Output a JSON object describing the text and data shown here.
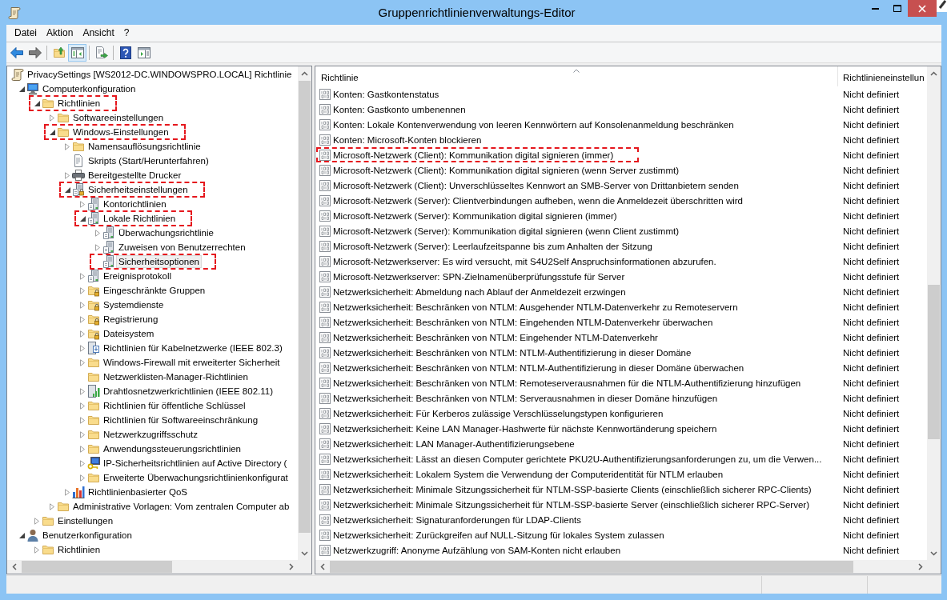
{
  "window": {
    "title": "Gruppenrichtlinienverwaltungs-Editor"
  },
  "menu": [
    {
      "label": "Datei"
    },
    {
      "label": "Aktion"
    },
    {
      "label": "Ansicht"
    },
    {
      "label": "?"
    }
  ],
  "toolbar": {
    "groups": [
      [
        {
          "kind": "back",
          "disabled": false,
          "pressed": false
        },
        {
          "kind": "forward",
          "disabled": true,
          "pressed": false
        }
      ],
      [
        {
          "kind": "up",
          "disabled": false,
          "pressed": false
        },
        {
          "kind": "tree",
          "disabled": false,
          "pressed": true
        }
      ],
      [
        {
          "kind": "export",
          "disabled": false,
          "pressed": false
        }
      ],
      [
        {
          "kind": "help",
          "disabled": false,
          "pressed": false
        },
        {
          "kind": "actions",
          "disabled": false,
          "pressed": false
        }
      ]
    ]
  },
  "console_tree": {
    "items": [
      {
        "label": "PrivacySettings [WS2012-DC.WINDOWSPRO.LOCAL] Richtlinie",
        "kind": "scroll",
        "selected": false,
        "highlighted": false,
        "children": [
          {
            "label": "Computerkonfiguration",
            "kind": "computer",
            "expanded": true,
            "selected": false,
            "highlighted": false,
            "children": [
              {
                "label": "Richtlinien",
                "kind": "folder",
                "expanded": true,
                "selected": false,
                "highlighted": true,
                "children": [
                  {
                    "label": "Softwareeinstellungen",
                    "kind": "folder",
                    "expanded": false,
                    "selected": false,
                    "highlighted": false
                  },
                  {
                    "label": "Windows-Einstellungen",
                    "kind": "folder",
                    "expanded": true,
                    "selected": false,
                    "highlighted": true,
                    "children": [
                      {
                        "label": "Namensauflösungsrichtlinie",
                        "kind": "folder",
                        "expanded": false,
                        "selected": false,
                        "highlighted": false
                      },
                      {
                        "label": "Skripts (Start/Herunterfahren)",
                        "kind": "script",
                        "selected": false,
                        "highlighted": false
                      },
                      {
                        "label": "Bereitgestellte Drucker",
                        "kind": "printer",
                        "expanded": false,
                        "selected": false,
                        "highlighted": false
                      },
                      {
                        "label": "Sicherheitseinstellungen",
                        "kind": "secured",
                        "expanded": true,
                        "selected": false,
                        "highlighted": true,
                        "children": [
                          {
                            "label": "Kontorichtlinien",
                            "kind": "policy",
                            "expanded": false,
                            "selected": false,
                            "highlighted": false
                          },
                          {
                            "label": "Lokale Richtlinien",
                            "kind": "policy",
                            "expanded": true,
                            "selected": false,
                            "highlighted": true,
                            "children": [
                              {
                                "label": "Überwachungsrichtlinie",
                                "kind": "policy",
                                "expanded": false,
                                "selected": false,
                                "highlighted": false
                              },
                              {
                                "label": "Zuweisen von Benutzerrechten",
                                "kind": "policy",
                                "expanded": false,
                                "selected": false,
                                "highlighted": false
                              },
                              {
                                "label": "Sicherheitsoptionen",
                                "kind": "policy",
                                "selected": true,
                                "highlighted": true
                              }
                            ]
                          },
                          {
                            "label": "Ereignisprotokoll",
                            "kind": "policy",
                            "expanded": false,
                            "selected": false,
                            "highlighted": false
                          },
                          {
                            "label": "Eingeschränkte Gruppen",
                            "kind": "lockfolder",
                            "expanded": false,
                            "selected": false,
                            "highlighted": false
                          },
                          {
                            "label": "Systemdienste",
                            "kind": "lockfolder",
                            "expanded": false,
                            "selected": false,
                            "highlighted": false
                          },
                          {
                            "label": "Registrierung",
                            "kind": "lockfolder",
                            "expanded": false,
                            "selected": false,
                            "highlighted": false
                          },
                          {
                            "label": "Dateisystem",
                            "kind": "lockfolder",
                            "expanded": false,
                            "selected": false,
                            "highlighted": false
                          },
                          {
                            "label": "Richtlinien für Kabelnetzwerke (IEEE 802.3)",
                            "kind": "wired",
                            "expanded": false,
                            "selected": false,
                            "highlighted": false
                          },
                          {
                            "label": "Windows-Firewall mit erweiterter Sicherheit",
                            "kind": "folder",
                            "expanded": false,
                            "selected": false,
                            "highlighted": false
                          },
                          {
                            "label": "Netzwerklisten-Manager-Richtlinien",
                            "kind": "folder",
                            "selected": false,
                            "highlighted": false
                          },
                          {
                            "label": "Drahtlosnetzwerkrichtlinien (IEEE 802.11)",
                            "kind": "wireless",
                            "expanded": false,
                            "selected": false,
                            "highlighted": false
                          },
                          {
                            "label": "Richtlinien für öffentliche Schlüssel",
                            "kind": "folder",
                            "expanded": false,
                            "selected": false,
                            "highlighted": false
                          },
                          {
                            "label": "Richtlinien für Softwareeinschränkung",
                            "kind": "folder",
                            "expanded": false,
                            "selected": false,
                            "highlighted": false
                          },
                          {
                            "label": "Netzwerkzugriffsschutz",
                            "kind": "folder",
                            "expanded": false,
                            "selected": false,
                            "highlighted": false
                          },
                          {
                            "label": "Anwendungssteuerungsrichtlinien",
                            "kind": "folder",
                            "expanded": false,
                            "selected": false,
                            "highlighted": false
                          },
                          {
                            "label": "IP-Sicherheitsrichtlinien auf Active Directory (",
                            "kind": "ipsec",
                            "expanded": false,
                            "selected": false,
                            "highlighted": false
                          },
                          {
                            "label": "Erweiterte Überwachungsrichtlinienkonfigurat",
                            "kind": "folder",
                            "expanded": false,
                            "selected": false,
                            "highlighted": false
                          }
                        ]
                      },
                      {
                        "label": "Richtlinienbasierter QoS",
                        "kind": "qos",
                        "expanded": false,
                        "selected": false,
                        "highlighted": false
                      }
                    ]
                  },
                  {
                    "label": "Administrative Vorlagen: Vom zentralen Computer ab",
                    "kind": "folder",
                    "expanded": false,
                    "selected": false,
                    "highlighted": false
                  }
                ]
              },
              {
                "label": "Einstellungen",
                "kind": "folder",
                "expanded": false,
                "selected": false,
                "highlighted": false
              }
            ]
          },
          {
            "label": "Benutzerkonfiguration",
            "kind": "user",
            "expanded": true,
            "selected": false,
            "highlighted": false,
            "children": [
              {
                "label": "Richtlinien",
                "kind": "folder",
                "expanded": false,
                "selected": false,
                "highlighted": false
              }
            ]
          }
        ]
      }
    ]
  },
  "policy_list": {
    "columns": [
      {
        "label": "Richtlinie",
        "sorted": true
      },
      {
        "label": "Richtlinieneinstellun",
        "sorted": false
      }
    ],
    "rows": [
      {
        "policy": "Konten: Gastkontenstatus",
        "setting": "Nicht definiert",
        "highlighted": false
      },
      {
        "policy": "Konten: Gastkonto umbenennen",
        "setting": "Nicht definiert",
        "highlighted": false
      },
      {
        "policy": "Konten: Lokale Kontenverwendung von leeren Kennwörtern auf Konsolenanmeldung beschränken",
        "setting": "Nicht definiert",
        "highlighted": false
      },
      {
        "policy": "Konten: Microsoft-Konten blockieren",
        "setting": "Nicht definiert",
        "highlighted": false
      },
      {
        "policy": "Microsoft-Netzwerk (Client): Kommunikation digital signieren (immer)",
        "setting": "Nicht definiert",
        "highlighted": true
      },
      {
        "policy": "Microsoft-Netzwerk (Client): Kommunikation digital signieren (wenn Server zustimmt)",
        "setting": "Nicht definiert",
        "highlighted": false
      },
      {
        "policy": "Microsoft-Netzwerk (Client): Unverschlüsseltes Kennwort an SMB-Server von Drittanbietern senden",
        "setting": "Nicht definiert",
        "highlighted": false
      },
      {
        "policy": "Microsoft-Netzwerk (Server): Clientverbindungen aufheben, wenn die Anmeldezeit überschritten wird",
        "setting": "Nicht definiert",
        "highlighted": false
      },
      {
        "policy": "Microsoft-Netzwerk (Server): Kommunikation digital signieren (immer)",
        "setting": "Nicht definiert",
        "highlighted": false
      },
      {
        "policy": "Microsoft-Netzwerk (Server): Kommunikation digital signieren (wenn Client zustimmt)",
        "setting": "Nicht definiert",
        "highlighted": false
      },
      {
        "policy": "Microsoft-Netzwerk (Server): Leerlaufzeitspanne bis zum Anhalten der Sitzung",
        "setting": "Nicht definiert",
        "highlighted": false
      },
      {
        "policy": "Microsoft-Netzwerkserver: Es wird versucht, mit S4U2Self Anspruchsinformationen abzurufen.",
        "setting": "Nicht definiert",
        "highlighted": false
      },
      {
        "policy": "Microsoft-Netzwerkserver: SPN-Zielnamenüberprüfungsstufe für Server",
        "setting": "Nicht definiert",
        "highlighted": false
      },
      {
        "policy": "Netzwerksicherheit: Abmeldung nach Ablauf der Anmeldezeit erzwingen",
        "setting": "Nicht definiert",
        "highlighted": false
      },
      {
        "policy": "Netzwerksicherheit: Beschränken von NTLM: Ausgehender NTLM-Datenverkehr zu Remoteservern",
        "setting": "Nicht definiert",
        "highlighted": false
      },
      {
        "policy": "Netzwerksicherheit: Beschränken von NTLM: Eingehenden NTLM-Datenverkehr überwachen",
        "setting": "Nicht definiert",
        "highlighted": false
      },
      {
        "policy": "Netzwerksicherheit: Beschränken von NTLM: Eingehender NTLM-Datenverkehr",
        "setting": "Nicht definiert",
        "highlighted": false
      },
      {
        "policy": "Netzwerksicherheit: Beschränken von NTLM: NTLM-Authentifizierung in dieser Domäne",
        "setting": "Nicht definiert",
        "highlighted": false
      },
      {
        "policy": "Netzwerksicherheit: Beschränken von NTLM: NTLM-Authentifizierung in dieser Domäne überwachen",
        "setting": "Nicht definiert",
        "highlighted": false
      },
      {
        "policy": "Netzwerksicherheit: Beschränken von NTLM: Remoteserverausnahmen für die NTLM-Authentifizierung hinzufügen",
        "setting": "Nicht definiert",
        "highlighted": false
      },
      {
        "policy": "Netzwerksicherheit: Beschränken von NTLM: Serverausnahmen in dieser Domäne hinzufügen",
        "setting": "Nicht definiert",
        "highlighted": false
      },
      {
        "policy": "Netzwerksicherheit: Für Kerberos zulässige Verschlüsselungstypen konfigurieren",
        "setting": "Nicht definiert",
        "highlighted": false
      },
      {
        "policy": "Netzwerksicherheit: Keine LAN Manager-Hashwerte für nächste Kennwortänderung speichern",
        "setting": "Nicht definiert",
        "highlighted": false
      },
      {
        "policy": "Netzwerksicherheit: LAN Manager-Authentifizierungsebene",
        "setting": "Nicht definiert",
        "highlighted": false
      },
      {
        "policy": "Netzwerksicherheit: Lässt an diesen Computer gerichtete PKU2U-Authentifizierungsanforderungen zu, um die Verwen...",
        "setting": "Nicht definiert",
        "highlighted": false
      },
      {
        "policy": "Netzwerksicherheit: Lokalem System die Verwendung der Computeridentität für NTLM erlauben",
        "setting": "Nicht definiert",
        "highlighted": false
      },
      {
        "policy": "Netzwerksicherheit: Minimale Sitzungssicherheit für NTLM-SSP-basierte Clients (einschließlich sicherer RPC-Clients)",
        "setting": "Nicht definiert",
        "highlighted": false
      },
      {
        "policy": "Netzwerksicherheit: Minimale Sitzungssicherheit für NTLM-SSP-basierte Server (einschließlich sicherer RPC-Server)",
        "setting": "Nicht definiert",
        "highlighted": false
      },
      {
        "policy": "Netzwerksicherheit: Signaturanforderungen für LDAP-Clients",
        "setting": "Nicht definiert",
        "highlighted": false
      },
      {
        "policy": "Netzwerksicherheit: Zurückgreifen auf NULL-Sitzung für lokales System zulassen",
        "setting": "Nicht definiert",
        "highlighted": false
      },
      {
        "policy": "Netzwerkzugriff: Anonyme Aufzählung von SAM-Konten nicht erlauben",
        "setting": "Nicht definiert",
        "highlighted": false
      }
    ]
  }
}
